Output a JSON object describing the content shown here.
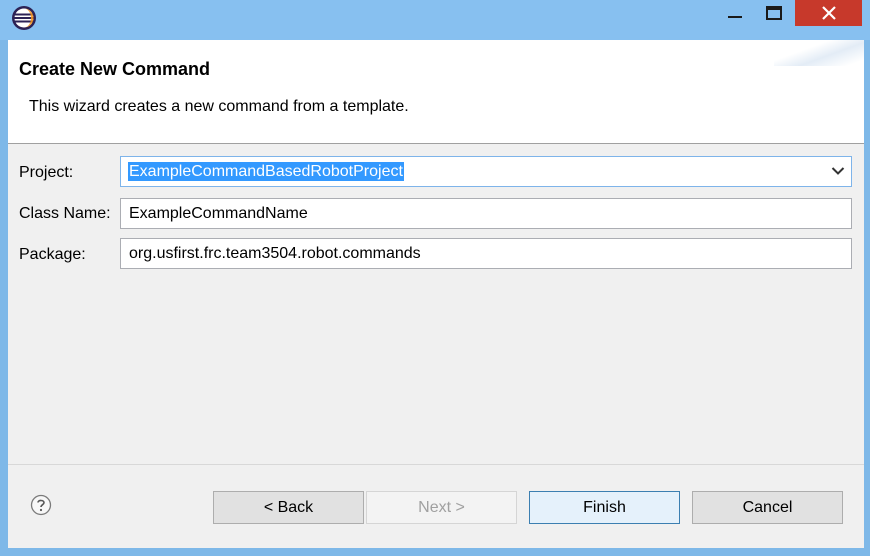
{
  "window": {
    "app_icon": "eclipse-icon",
    "controls": [
      "minimize-icon",
      "maximize-icon",
      "close-icon"
    ]
  },
  "header": {
    "title": "Create New Command",
    "message": "This wizard creates a new command from a template."
  },
  "form": {
    "project_label": "Project:",
    "project_value": "ExampleCommandBasedRobotProject",
    "class_name_label": "Class Name:",
    "class_name_value": "ExampleCommandName",
    "package_label": "Package:",
    "package_value": "org.usfirst.frc.team3504.robot.commands"
  },
  "buttons": {
    "back": "< Back",
    "next": "Next >",
    "finish": "Finish",
    "cancel": "Cancel"
  },
  "colors": {
    "titlebar": "#87c0f0",
    "close_button": "#c7392b",
    "selection": "#3399ff"
  }
}
